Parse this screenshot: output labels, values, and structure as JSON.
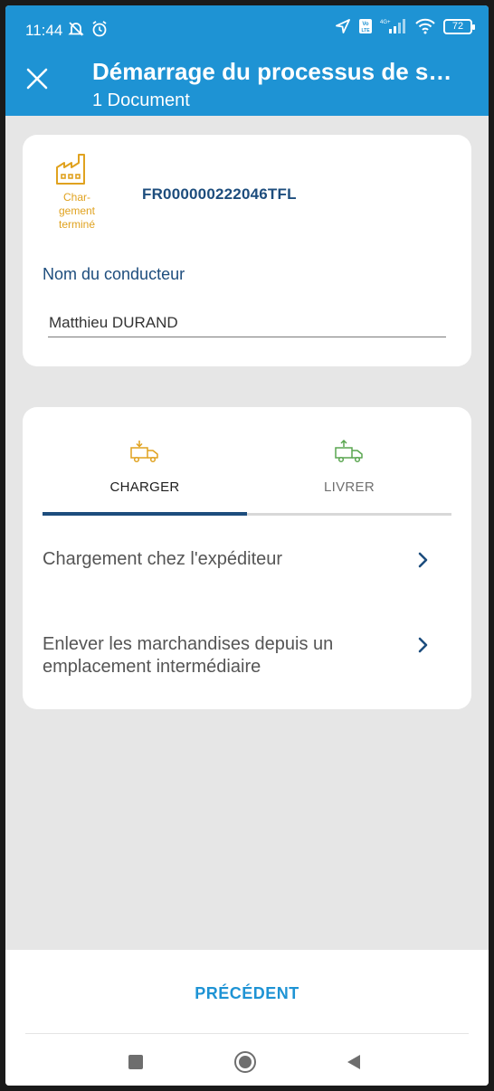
{
  "status_bar": {
    "time": "11:44",
    "battery": "72",
    "icons": [
      "mute-bell-icon",
      "alarm-icon",
      "location-arrow-icon",
      "volte-icon",
      "signal-4g-icon",
      "wifi-icon",
      "battery-icon"
    ]
  },
  "app_bar": {
    "title": "Démarrage du processus de si…",
    "subtitle": "1 Document",
    "close_icon": "close-icon"
  },
  "document": {
    "status_label": "Char-\ngement\nterminé",
    "status_icon": "factory-icon",
    "id": "FR000000222046TFL",
    "driver_label": "Nom du conducteur",
    "driver_value": "Matthieu DURAND"
  },
  "tabs": [
    {
      "label": "CHARGER",
      "icon": "truck-load-icon",
      "active": true
    },
    {
      "label": "LIVRER",
      "icon": "truck-unload-icon",
      "active": false
    }
  ],
  "actions": [
    {
      "label": "Chargement chez l'expéditeur",
      "icon": "chevron-right-icon"
    },
    {
      "label": "Enlever les marchandises depuis un emplacement intermédiaire",
      "icon": "chevron-right-icon"
    }
  ],
  "footer": {
    "previous_label": "PRÉCÉDENT"
  },
  "colors": {
    "primary": "#1e93d4",
    "navy": "#1d4d7d",
    "amber": "#e0a21f",
    "green": "#5aa650",
    "background": "#e6e6e6"
  }
}
